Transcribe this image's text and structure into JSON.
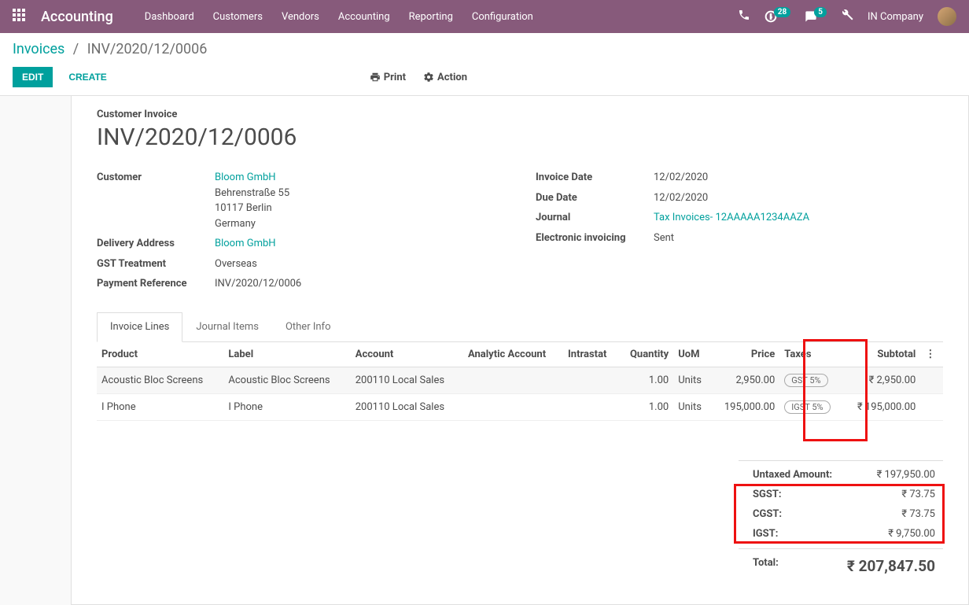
{
  "navbar": {
    "brand": "Accounting",
    "menu": [
      "Dashboard",
      "Customers",
      "Vendors",
      "Accounting",
      "Reporting",
      "Configuration"
    ],
    "activities_count": "28",
    "messages_count": "5",
    "company": "IN Company"
  },
  "breadcrumb": {
    "root": "Invoices",
    "current": "INV/2020/12/0006"
  },
  "buttons": {
    "edit": "EDIT",
    "create": "CREATE",
    "print": "Print",
    "action": "Action"
  },
  "form": {
    "title_label": "Customer Invoice",
    "title": "INV/2020/12/0006",
    "left": {
      "customer_label": "Customer",
      "customer_name": "Bloom GmbH",
      "customer_addr1": "Behrenstraße 55",
      "customer_addr2": "10117 Berlin",
      "customer_addr3": "Germany",
      "delivery_label": "Delivery Address",
      "delivery_value": "Bloom GmbH",
      "gst_label": "GST Treatment",
      "gst_value": "Overseas",
      "payref_label": "Payment Reference",
      "payref_value": "INV/2020/12/0006"
    },
    "right": {
      "invdate_label": "Invoice Date",
      "invdate_value": "12/02/2020",
      "duedate_label": "Due Date",
      "duedate_value": "12/02/2020",
      "journal_label": "Journal",
      "journal_value": "Tax Invoices- 12AAAAA1234AAZA",
      "einv_label": "Electronic invoicing",
      "einv_value": "Sent"
    }
  },
  "tabs": {
    "invoice_lines": "Invoice Lines",
    "journal_items": "Journal Items",
    "other_info": "Other Info"
  },
  "table": {
    "headers": {
      "product": "Product",
      "label": "Label",
      "account": "Account",
      "analytic": "Analytic Account",
      "intrastat": "Intrastat",
      "quantity": "Quantity",
      "uom": "UoM",
      "price": "Price",
      "taxes": "Taxes",
      "subtotal": "Subtotal"
    },
    "rows": [
      {
        "product": "Acoustic Bloc Screens",
        "label": "Acoustic Bloc Screens",
        "account": "200110 Local Sales",
        "analytic": "",
        "intrastat": "",
        "quantity": "1.00",
        "uom": "Units",
        "price": "2,950.00",
        "taxes": "GST 5%",
        "subtotal": "₹ 2,950.00"
      },
      {
        "product": "I Phone",
        "label": "I Phone",
        "account": "200110 Local Sales",
        "analytic": "",
        "intrastat": "",
        "quantity": "1.00",
        "uom": "Units",
        "price": "195,000.00",
        "taxes": "IGST 5%",
        "subtotal": "₹ 195,000.00"
      }
    ]
  },
  "totals": {
    "untaxed_label": "Untaxed Amount:",
    "untaxed_value": "₹ 197,950.00",
    "sgst_label": "SGST:",
    "sgst_value": "₹ 73.75",
    "cgst_label": "CGST:",
    "cgst_value": "₹ 73.75",
    "igst_label": "IGST:",
    "igst_value": "₹ 9,750.00",
    "total_label": "Total:",
    "total_value": "₹ 207,847.50"
  }
}
